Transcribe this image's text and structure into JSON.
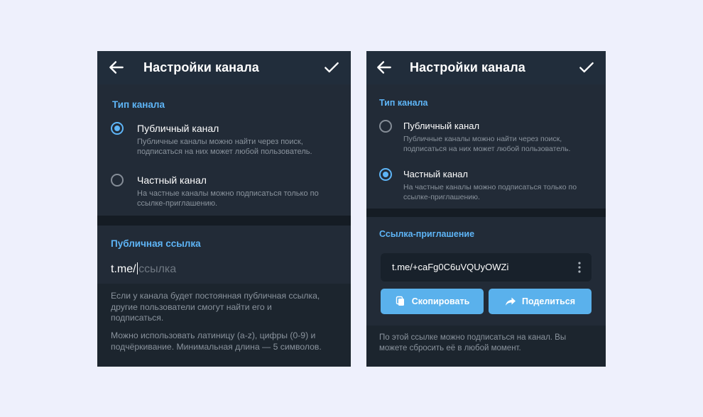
{
  "left": {
    "title": "Настройки канала",
    "channel_type_header": "Тип канала",
    "public_option": {
      "label": "Публичный канал",
      "description": "Публичные каналы можно найти через поиск, подписаться на них может любой пользователь.",
      "selected": true
    },
    "private_option": {
      "label": "Частный канал",
      "description": "На частные каналы можно подписаться только по ссылке-приглашению.",
      "selected": false
    },
    "link_header": "Публичная ссылка",
    "link_prefix": "t.me/",
    "link_placeholder": "ссылка",
    "note1": "Если у канала будет постоянная публичная ссылка, другие пользователи смогут найти его и подписаться.",
    "note2": "Можно использовать латиницу (a-z), цифры (0-9) и подчёркивание. Минимальная длина — 5 символов."
  },
  "right": {
    "title": "Настройки канала",
    "channel_type_header": "Тип канала",
    "public_option": {
      "label": "Публичный канал",
      "description": "Публичные каналы можно найти через поиск, подписаться на них может любой пользователь.",
      "selected": false
    },
    "private_option": {
      "label": "Частный канал",
      "description": "На частные каналы можно подписаться только по ссылке-приглашению.",
      "selected": true
    },
    "invite_header": "Ссылка-приглашение",
    "invite_link": "t.me/+caFg0C6uVQUyOWZi",
    "copy_button": "Скопировать",
    "share_button": "Поделиться",
    "note": "По этой ссылке можно подписаться на канал. Вы можете сбросить её в любой момент."
  },
  "colors": {
    "accent": "#5eb5f7",
    "button": "#5ab1ec",
    "background": "#1c252e",
    "page_background": "#eef0fc"
  },
  "icons": [
    "back-arrow-icon",
    "checkmark-icon",
    "more-vertical-icon",
    "copy-icon",
    "share-arrow-icon"
  ]
}
